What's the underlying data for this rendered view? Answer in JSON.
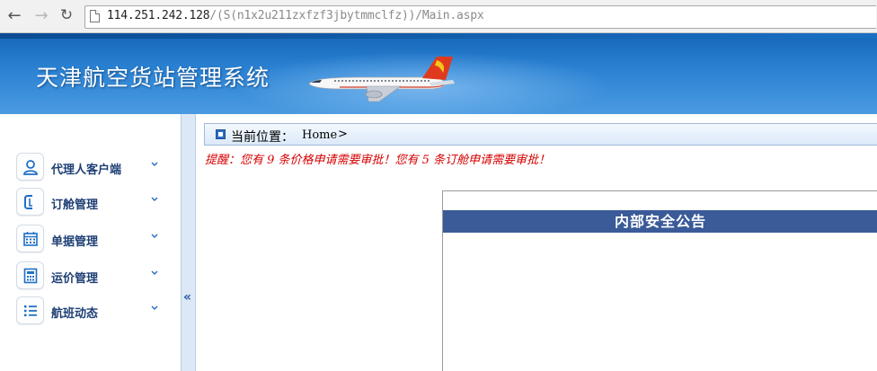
{
  "browser": {
    "back_icon": "back-arrow-icon",
    "forward_icon": "forward-arrow-icon",
    "reload_icon": "reload-icon",
    "url_host": "114.251.242.128",
    "url_path": "/(S(n1x2u211zxfzf3jbytmmclfz))/Main.aspx"
  },
  "header": {
    "title": "天津航空货站管理系统",
    "brand_colors": {
      "banner_top": "#1466b8",
      "banner_bottom": "#4a9ae0",
      "plane_tail": "#e03a1e"
    }
  },
  "sidebar": {
    "items": [
      {
        "label": "代理人客户端",
        "icon": "person-icon"
      },
      {
        "label": "订舱管理",
        "icon": "booking-icon"
      },
      {
        "label": "单据管理",
        "icon": "calendar-icon"
      },
      {
        "label": "运价管理",
        "icon": "calculator-icon"
      },
      {
        "label": "航班动态",
        "icon": "list-icon"
      }
    ],
    "collapse_glyph": "«"
  },
  "breadcrumb": {
    "label": "当前位置：",
    "value": "Home",
    "chevron": ">"
  },
  "notice": {
    "text": "提醒：您有 9 条价格申请需要审批！您有 5 条订舱申请需要审批！",
    "color": "#d60000"
  },
  "announcement": {
    "title": "内部安全公告"
  }
}
